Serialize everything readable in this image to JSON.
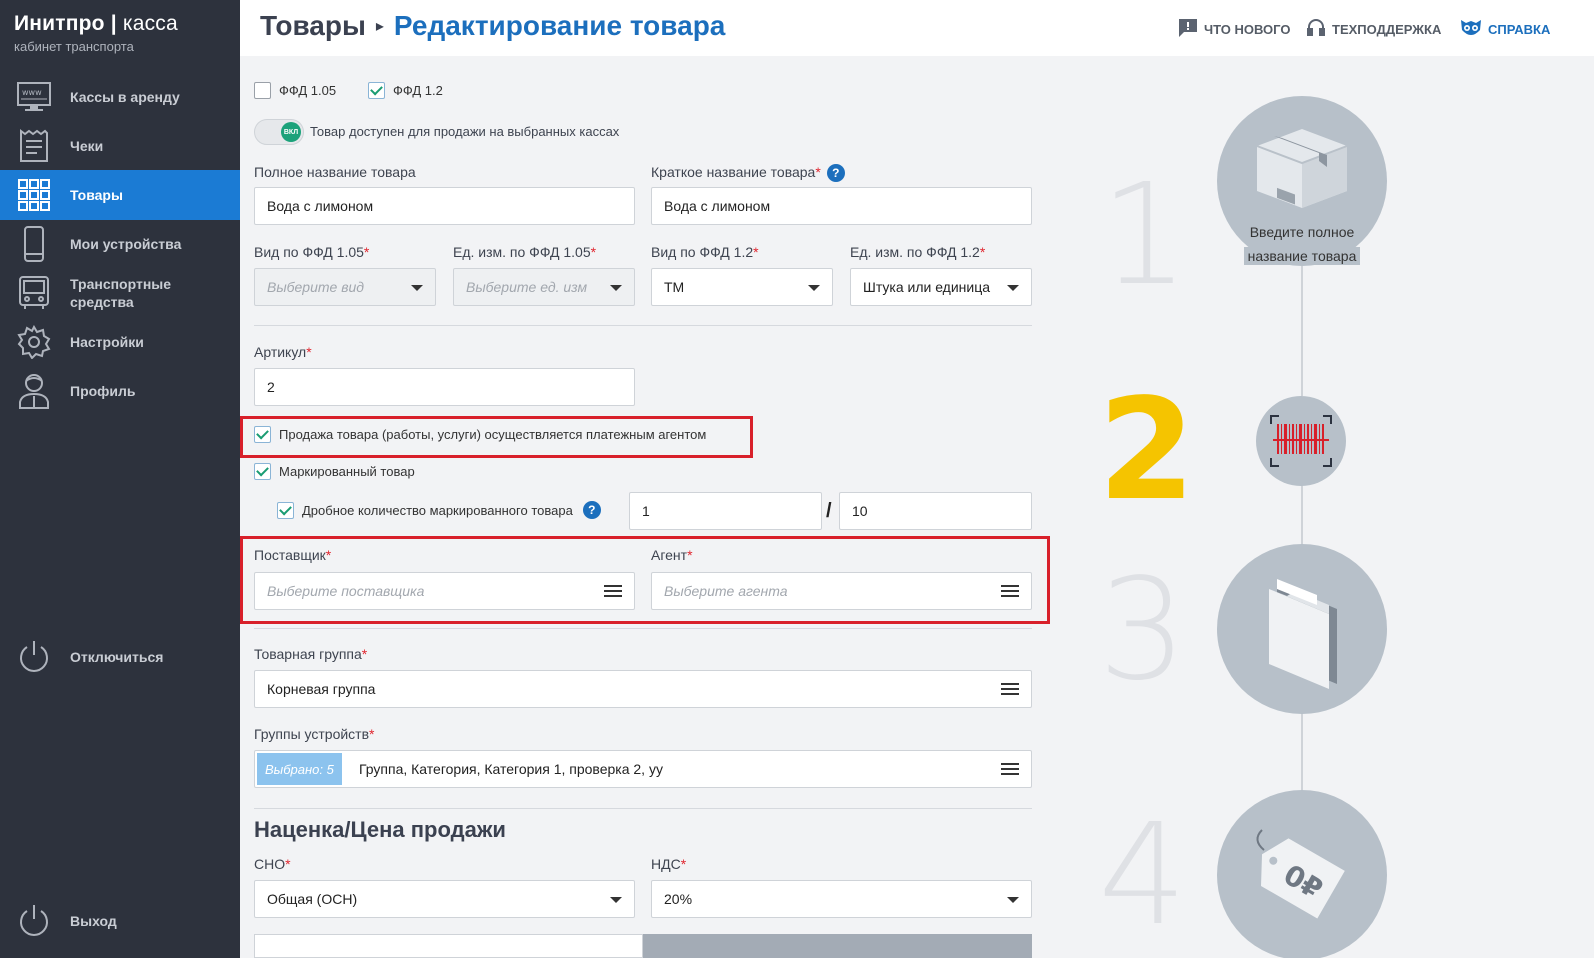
{
  "brand": {
    "name": "Инитпро",
    "name2": "касса",
    "sub": "кабинет транспорта"
  },
  "nav": {
    "items": [
      {
        "label": "Кассы в аренду"
      },
      {
        "label": "Чеки"
      },
      {
        "label": "Товары"
      },
      {
        "label": "Мои устройства"
      },
      {
        "label": "Транспортные средства"
      },
      {
        "label": "Настройки"
      },
      {
        "label": "Профиль"
      }
    ],
    "disconnect": "Отключиться",
    "logout": "Выход"
  },
  "header": {
    "crumb_root": "Товары",
    "crumb_current": "Редактирование товара",
    "whats_new": "ЧТО НОВОГО",
    "support": "ТЕХПОДДЕРЖКА",
    "help": "СПРАВКА"
  },
  "form": {
    "ffd105": "ФФД 1.05",
    "ffd12": "ФФД 1.2",
    "toggle_label": "Товар доступен для продажи на выбранных кассах",
    "toggle_state": "ВКЛ",
    "full_name_label": "Полное название товара",
    "full_name_value": "Вода с лимоном",
    "short_name_label": "Краткое название товара",
    "short_name_value": "Вода с лимоном",
    "kind105_label": "Вид по ФФД 1.05",
    "kind105_placeholder": "Выберите вид",
    "unit105_label": "Ед. изм. по ФФД 1.05",
    "unit105_placeholder": "Выберите ед. изм",
    "kind12_label": "Вид по ФФД 1.2",
    "kind12_value": "ТМ",
    "unit12_label": "Ед. изм. по ФФД 1.2",
    "unit12_value": "Штука или единица",
    "sku_label": "Артикул",
    "sku_value": "2",
    "agent_sale": "Продажа товара (работы, услуги) осуществляется платежным агентом",
    "marked": "Маркированный товар",
    "fractional": "Дробное количество маркированного товара",
    "fraction_num": "1",
    "fraction_sep": "/",
    "fraction_den": "10",
    "supplier_label": "Поставщик",
    "supplier_placeholder": "Выберите поставщика",
    "agent_label": "Агент",
    "agent_placeholder": "Выберите агента",
    "group_label": "Товарная группа",
    "group_value": "Корневая группа",
    "devgroups_label": "Группы устройств",
    "devgroups_badge": "Выбрано: 5",
    "devgroups_value": "Группа, Категория, Категория 1, проверка 2, уу",
    "pricing_title": "Наценка/Цена продажи",
    "sno_label": "СНО",
    "sno_value": "Общая (ОСН)",
    "vat_label": "НДС",
    "vat_value": "20%"
  },
  "steps": {
    "n1": "1",
    "n2": "2",
    "n3": "3",
    "n4": "4",
    "step1_caption_line1": "Введите полное",
    "step1_caption_line2": "название товара",
    "price_tag": "0₽"
  }
}
